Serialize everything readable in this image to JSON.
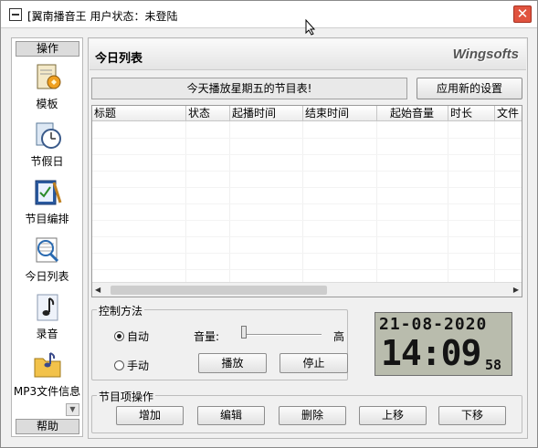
{
  "window": {
    "title": "[翼南播音王  用户状态：未登陆",
    "close": "✕"
  },
  "sidebar": {
    "header": "操作",
    "footer": "帮助",
    "items": [
      {
        "label": "模板",
        "icon": "template-icon"
      },
      {
        "label": "节假日",
        "icon": "holiday-clock-icon"
      },
      {
        "label": "节目编排",
        "icon": "schedule-edit-icon"
      },
      {
        "label": "今日列表",
        "icon": "today-list-icon"
      },
      {
        "label": "录音",
        "icon": "music-note-icon"
      },
      {
        "label": "MP3文件信息",
        "icon": "folder-music-icon"
      }
    ]
  },
  "header": {
    "title": "今日列表",
    "brand": "Wingsofts"
  },
  "notice": "今天播放星期五的节目表!",
  "apply_button": "应用新的设置",
  "table": {
    "columns": [
      "标题",
      "状态",
      "起播时间",
      "结束时间",
      "起始音量",
      "时长",
      "文件"
    ]
  },
  "control": {
    "title": "控制方法",
    "auto_label": "自动",
    "manual_label": "手动",
    "mode": "自动",
    "volume_label": "音量:",
    "volume_high": "高",
    "volume_level": 0,
    "play_button": "播放",
    "stop_button": "停止"
  },
  "clock": {
    "date": "21-08-2020",
    "time": "14:09",
    "seconds": "58"
  },
  "ops": {
    "title": "节目项操作",
    "add": "增加",
    "edit": "编辑",
    "delete": "删除",
    "up": "上移",
    "down": "下移"
  },
  "colors": {
    "close": "#e0533f",
    "lcd": "#b9bcad"
  }
}
